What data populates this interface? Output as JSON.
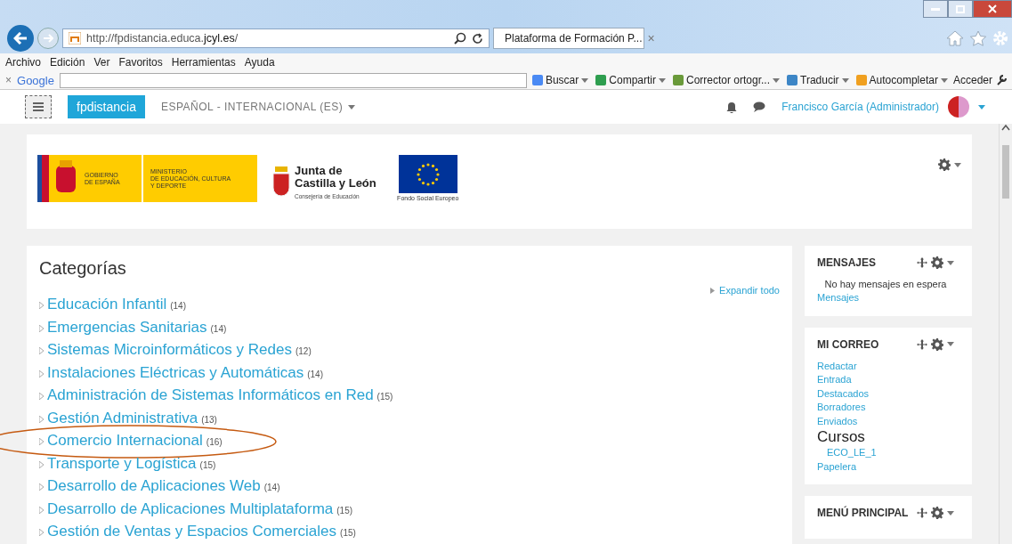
{
  "browser": {
    "url": "http://fpdistancia.educa.**jcyl.es**/",
    "tab_title": "Plataforma de Formación P...",
    "tab_close": "×",
    "menu": [
      "Archivo",
      "Edición",
      "Ver",
      "Favoritos",
      "Herramientas",
      "Ayuda"
    ],
    "toolbar_close": "×",
    "search_brand": "Google",
    "toolbar_items": [
      "Buscar",
      "Compartir",
      "Corrector ortogr...",
      "Traducir",
      "Autocompletar"
    ],
    "sign_in": "Acceder"
  },
  "navbar": {
    "brand": "fpdistancia",
    "language": "ESPAÑOL - INTERNACIONAL (ES)",
    "user": "Francisco García (Administrador)"
  },
  "header": {
    "gobierno": [
      "GOBIERNO",
      "DE ESPAÑA"
    ],
    "ministerio": [
      "MINISTERIO",
      "DE EDUCACIÓN, CULTURA",
      "Y DEPORTE"
    ],
    "junta": [
      "Junta de",
      "Castilla y León"
    ],
    "junta_sub": "Consejería de Educación",
    "eu": "Fondo Social Europeo"
  },
  "categories": {
    "title": "Categorías",
    "expand": "Expandir todo",
    "items": [
      {
        "name": "Educación Infantil",
        "count": "(14)",
        "circled": false
      },
      {
        "name": "Emergencias Sanitarias",
        "count": "(14)",
        "circled": false
      },
      {
        "name": "Sistemas Microinformáticos y Redes",
        "count": "(12)",
        "circled": false
      },
      {
        "name": "Instalaciones Eléctricas y Automáticas",
        "count": "(14)",
        "circled": false
      },
      {
        "name": "Administración de Sistemas Informáticos en Red",
        "count": "(15)",
        "circled": false
      },
      {
        "name": "Gestión Administrativa",
        "count": "(13)",
        "circled": false
      },
      {
        "name": "Comercio Internacional",
        "count": "(16)",
        "circled": true
      },
      {
        "name": "Transporte y Logística",
        "count": "(15)",
        "circled": false
      },
      {
        "name": "Desarrollo de Aplicaciones Web",
        "count": "(14)",
        "circled": false
      },
      {
        "name": "Desarrollo de Aplicaciones Multiplataforma",
        "count": "(15)",
        "circled": false
      },
      {
        "name": "Gestión de Ventas y Espacios Comerciales",
        "count": "(15)",
        "circled": false
      }
    ]
  },
  "blocks": [
    {
      "title": "MENSAJES",
      "items": [
        {
          "kind": "note",
          "text": "No hay mensajes en espera"
        },
        {
          "kind": "link",
          "text": "Mensajes"
        }
      ]
    },
    {
      "title": "MI CORREO",
      "items": [
        {
          "kind": "link",
          "text": "Redactar"
        },
        {
          "kind": "link",
          "text": "Entrada"
        },
        {
          "kind": "link",
          "text": "Destacados"
        },
        {
          "kind": "link",
          "text": "Borradores"
        },
        {
          "kind": "link",
          "text": "Enviados"
        },
        {
          "kind": "heading",
          "text": "Cursos"
        },
        {
          "kind": "sublink",
          "text": "ECO_LE_1"
        },
        {
          "kind": "link",
          "text": "Papelera"
        }
      ]
    },
    {
      "title": "MENÚ PRINCIPAL"
    }
  ]
}
